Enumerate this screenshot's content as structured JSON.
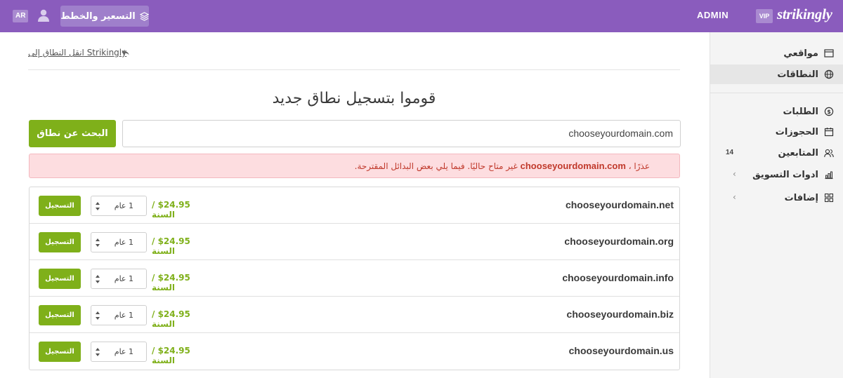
{
  "topbar": {
    "lang": "AR",
    "pricing_label": "التسعير والخطط",
    "admin_label": "ADMIN",
    "vip_label": "VIP",
    "brand": "strikingly",
    "bg_color": "#8a5cbd"
  },
  "sidebar": {
    "items": [
      {
        "label": "مواقعي",
        "icon": "window-icon"
      },
      {
        "label": "النطاقات",
        "icon": "globe-icon",
        "active": true
      },
      {
        "label": "الطلبات",
        "icon": "dollar-icon"
      },
      {
        "label": "الحجوزات",
        "icon": "calendar-icon"
      },
      {
        "label": "المتابعين",
        "icon": "users-icon",
        "count": "14"
      },
      {
        "label": "ادوات التسويق",
        "icon": "chart-icon"
      },
      {
        "label": "إضافات",
        "icon": "apps-icon"
      }
    ]
  },
  "main": {
    "back_link": "انقل النطاق إلى Strikingly",
    "title": "قوموا بتسجيل نطاق جديد",
    "search_value": "chooseyourdomain.com",
    "search_button": "البحث عن نطاق",
    "alert": {
      "prefix": "عذرًا ،",
      "domain": "chooseyourdomain.com",
      "suffix": "غير متاح حاليًا. فيما يلي بعض البدائل المقترحة."
    },
    "results": [
      {
        "domain": "chooseyourdomain.net",
        "price": "$24.95 / السنة",
        "years": "1 عام",
        "button": "التسجيل"
      },
      {
        "domain": "chooseyourdomain.org",
        "price": "$24.95 / السنة",
        "years": "1 عام",
        "button": "التسجيل"
      },
      {
        "domain": "chooseyourdomain.info",
        "price": "$24.95 / السنة",
        "years": "1 عام",
        "button": "التسجيل"
      },
      {
        "domain": "chooseyourdomain.biz",
        "price": "$24.95 / السنة",
        "years": "1 عام",
        "button": "التسجيل"
      },
      {
        "domain": "chooseyourdomain.us",
        "price": "$24.95 / السنة",
        "years": "1 عام",
        "button": "التسجيل"
      }
    ]
  },
  "colors": {
    "accent": "#7fb01a",
    "alert_bg": "#fddde0",
    "alert_text": "#c0392b"
  }
}
